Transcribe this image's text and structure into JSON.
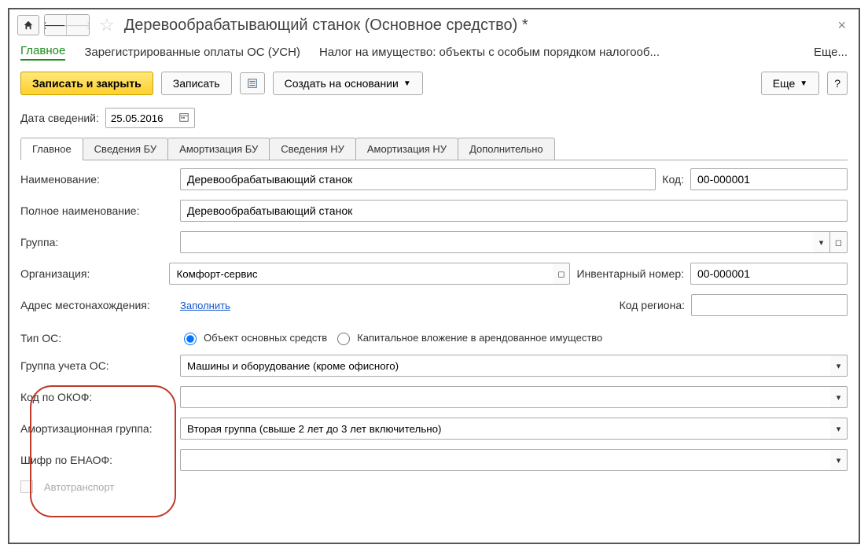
{
  "title": "Деревообрабатывающий станок (Основное средство) *",
  "mainTabs": {
    "t0": "Главное",
    "t1": "Зарегистрированные оплаты ОС (УСН)",
    "t2": "Налог на имущество: объекты с особым порядком налогооб...",
    "more": "Еще..."
  },
  "toolbar": {
    "saveClose": "Записать и закрыть",
    "save": "Записать",
    "createBased": "Создать на основании",
    "more": "Еще",
    "help": "?"
  },
  "dateLabel": "Дата сведений:",
  "dateValue": "25.05.2016",
  "subtabs": [
    "Главное",
    "Сведения БУ",
    "Амортизация БУ",
    "Сведения НУ",
    "Амортизация НУ",
    "Дополнительно"
  ],
  "form": {
    "nameLbl": "Наименование:",
    "nameVal": "Деревообрабатывающий станок",
    "codeLbl": "Код:",
    "codeVal": "00-000001",
    "fullNameLbl": "Полное наименование:",
    "fullNameVal": "Деревообрабатывающий станок",
    "groupLbl": "Группа:",
    "groupVal": "",
    "orgLbl": "Организация:",
    "orgVal": "Комфорт-сервис",
    "invLbl": "Инвентарный номер:",
    "invVal": "00-000001",
    "addrLbl": "Адрес местонахождения:",
    "addrLink": "Заполнить",
    "regionLbl": "Код региона:",
    "typeLbl": "Тип ОС:",
    "radio1": "Объект основных средств",
    "radio2": "Капитальное вложение в арендованное имущество",
    "accGroupLbl": "Группа учета ОС:",
    "accGroupVal": "Машины и оборудование (кроме офисного)",
    "okofLbl": "Код по ОКОФ:",
    "okofVal": "",
    "amortLbl": "Амортизационная группа:",
    "amortVal": "Вторая группа (свыше 2 лет до 3 лет включительно)",
    "enaofLbl": "Шифр по ЕНАОФ:",
    "enaofVal": "",
    "autoLbl": "Автотранспорт"
  }
}
